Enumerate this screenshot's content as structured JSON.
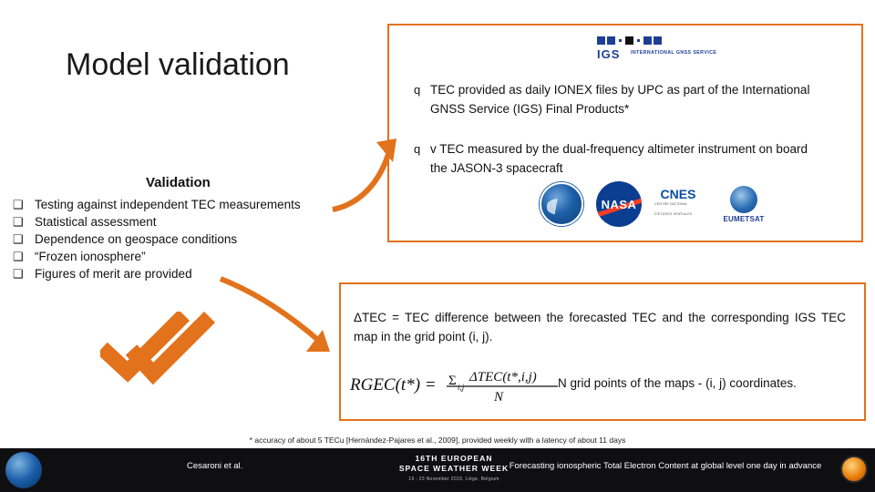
{
  "title": "Model validation",
  "validation": {
    "heading": "Validation",
    "bullet_glyph": "❑",
    "items": [
      "Testing against independent TEC measurements",
      "Statistical assessment",
      "Dependence on geospace conditions",
      "“Frozen ionosphere”",
      "Figures of merit are provided"
    ]
  },
  "top_box": {
    "bullet_glyph": "q",
    "bullets": [
      "TEC provided as daily IONEX files by UPC as part of the International GNSS Service (IGS) Final Products*",
      "v TEC measured by the dual-frequency altimeter instrument on board the JASON-3 spacecraft"
    ],
    "igs_logo": {
      "name": "IGS",
      "subtitle": "INTERNATIONAL GNSS SERVICE"
    },
    "agencies": [
      "NOAA",
      "NASA",
      "CNES",
      "EUMETSAT"
    ],
    "cnes_sub": "CENTRE NATIONAL D'ETUDES SPATIALES"
  },
  "bottom_box": {
    "delta_text": "ΔTEC = TEC difference between the forecasted TEC and the corresponding IGS TEC map in the grid point (i, j).",
    "formula_alt": "RGEC(t*) = Σ i,j ΔTEC(t*, i, j) / N",
    "ngrid_text": "N grid points of the maps - (i, j) coordinates."
  },
  "footnote": "* accuracy of about 5 TECu [Hernández-Pajares et al., 2009], provided weekly with a latency of about 11 days",
  "footer": {
    "author": "Cesaroni et al.",
    "event_line1": "16TH EUROPEAN",
    "event_line2": "SPACE WEATHER WEEK",
    "event_line3": "19 - 23 November 2019, Liège, Belgium",
    "right_text": "Forecasting ionospheric Total Electron Content at global level one day in advance"
  },
  "colors": {
    "accent": "#E2721B",
    "igs_blue": "#1C3F94",
    "footer_bg": "#0F0F12"
  }
}
